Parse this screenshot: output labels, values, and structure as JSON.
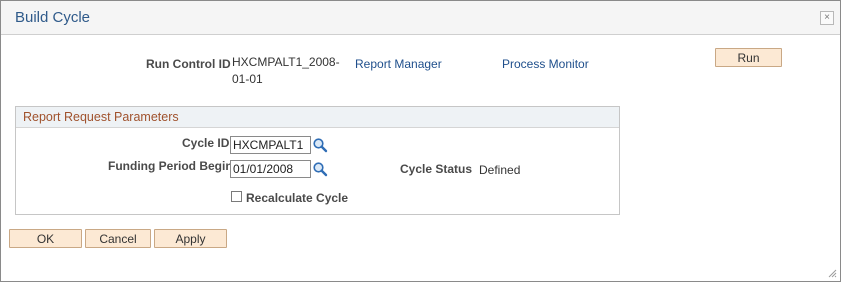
{
  "dialog": {
    "title": "Build Cycle",
    "close_glyph": "×"
  },
  "header": {
    "run_control_label": "Run Control ID",
    "run_control_value_line1": "HXCMPALT1_2008-",
    "run_control_value_line2": "01-01",
    "report_manager": "Report Manager",
    "process_monitor": "Process Monitor",
    "run_label": "Run"
  },
  "group": {
    "title": "Report Request Parameters",
    "cycle_id_label": "Cycle ID",
    "cycle_id_value": "HXCMPALT1",
    "funding_period_label": "Funding Period Begin",
    "funding_period_value": "01/01/2008",
    "cycle_status_label": "Cycle Status",
    "cycle_status_value": "Defined",
    "recalculate_label": "Recalculate Cycle",
    "recalculate_checked": false
  },
  "footer": {
    "ok_label": "OK",
    "cancel_label": "Cancel",
    "apply_label": "Apply"
  },
  "icons": {
    "lookup": "magnifier-icon",
    "close": "close-icon",
    "resize": "resize-grip-icon"
  },
  "colors": {
    "title": "#2f5a8a",
    "link": "#1f4f8c",
    "group_title": "#a0522d",
    "button_bg": "#fce9d4"
  }
}
